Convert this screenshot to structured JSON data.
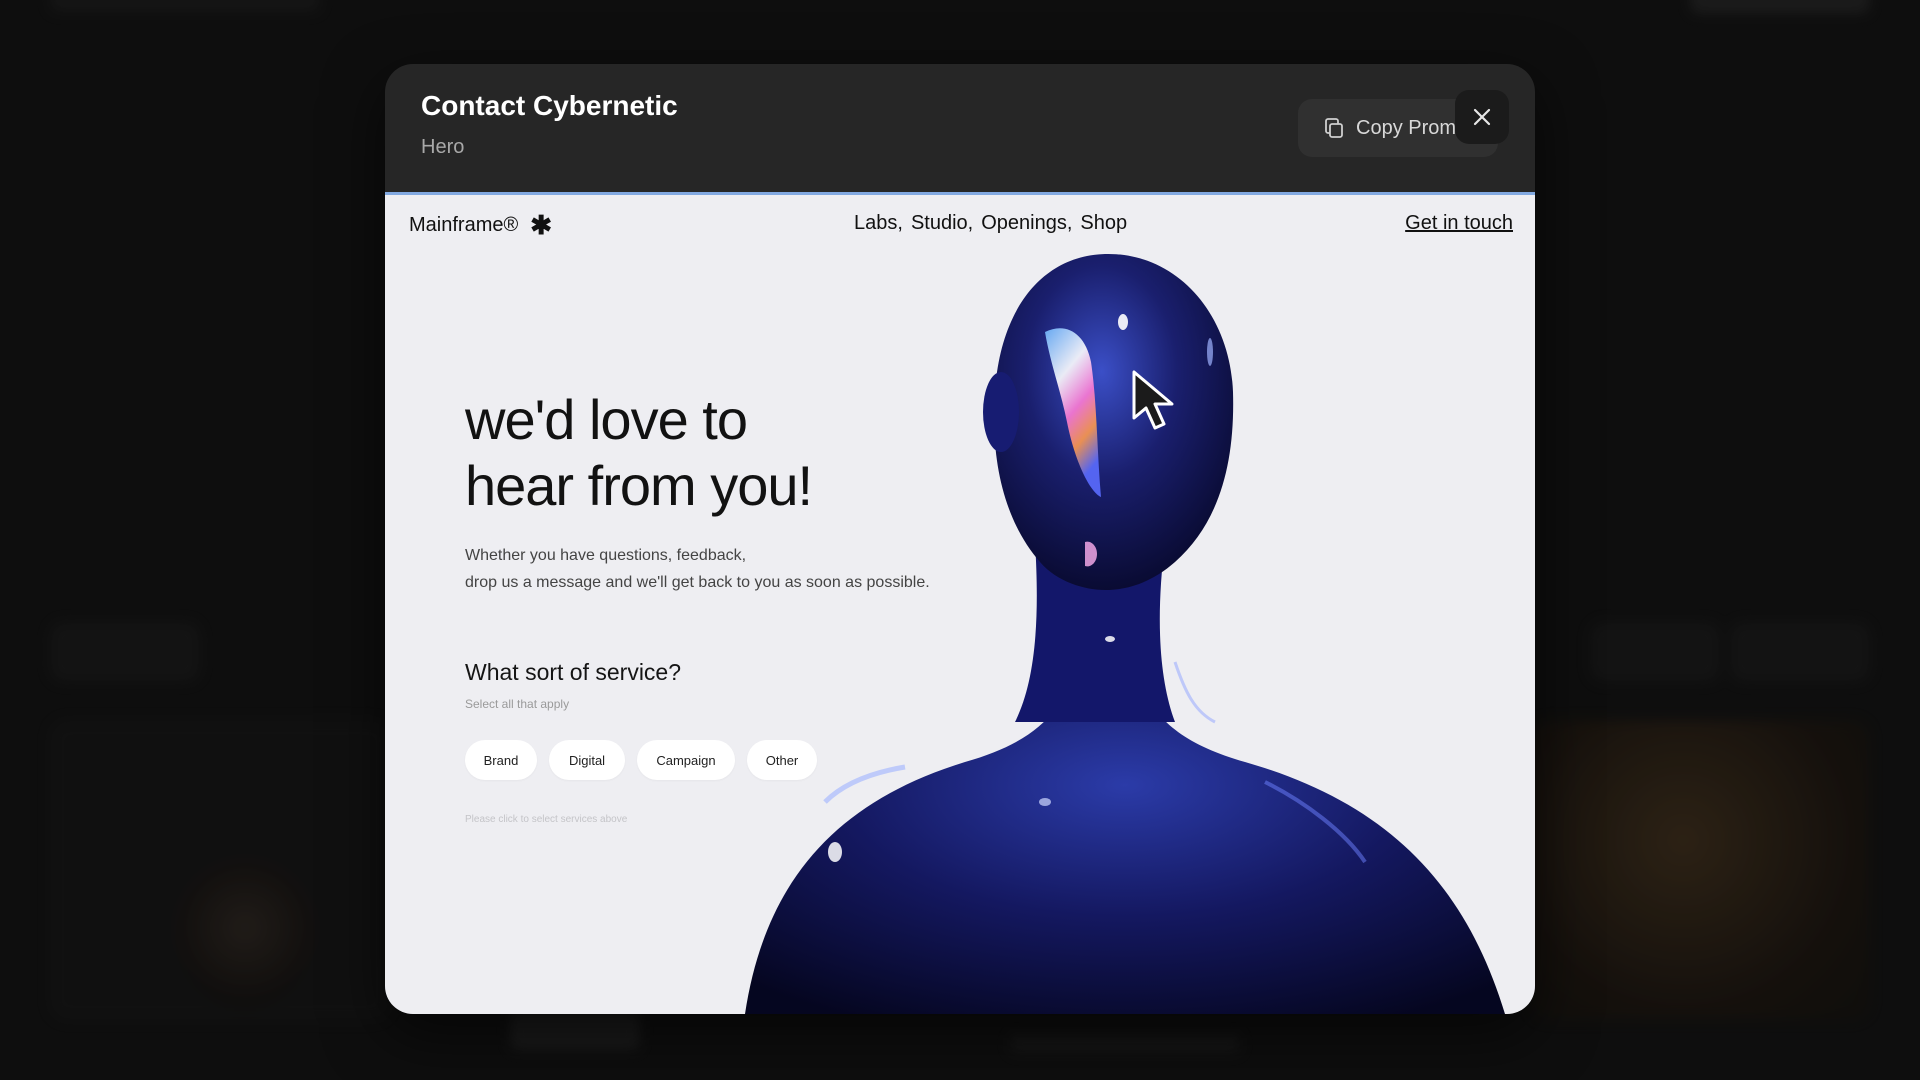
{
  "modal": {
    "title": "Contact Cybernetic",
    "subtitle": "Hero",
    "copy_button": "Copy Prom",
    "close_icon": "close-icon",
    "copy_icon": "copy-icon"
  },
  "preview": {
    "logo": "Mainframe®",
    "logo_mark": "✱",
    "nav": [
      {
        "label": "Labs",
        "sep": ","
      },
      {
        "label": "Studio",
        "sep": ","
      },
      {
        "label": "Openings",
        "sep": ","
      },
      {
        "label": "Shop",
        "sep": ""
      }
    ],
    "cta": "Get in touch",
    "headline_line1": "we'd love to",
    "headline_line2": "hear from you!",
    "body_line1": "Whether you have questions, feedback,",
    "body_line2": "drop us a message and we'll get back to you as soon as possible.",
    "question": "What sort of service?",
    "question_hint": "Select all that apply",
    "services": [
      "Brand",
      "Digital",
      "Campaign",
      "Other"
    ],
    "footnote": "Please click to select services above"
  },
  "colors": {
    "modal_bg": "#262626",
    "page_bg": "#161616",
    "preview_bg": "#eeeef2",
    "figure_blue": "#1a1f6e"
  }
}
